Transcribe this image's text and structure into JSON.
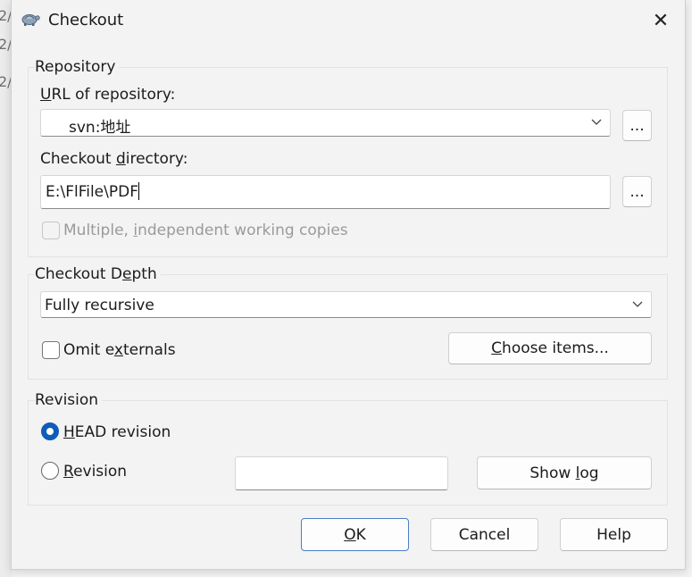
{
  "dialog": {
    "title": "Checkout",
    "close_symbol": "✕"
  },
  "repository": {
    "group_title": "Repository",
    "url_label_pre": "",
    "url_label_mnemonic": "U",
    "url_label_post": "RL of repository:",
    "url_value": "svn:地址",
    "browse_label": "...",
    "dir_label_pre": "Checkout ",
    "dir_label_mnemonic": "d",
    "dir_label_post": "irectory:",
    "dir_value": "E:\\FlFile\\PDF",
    "browse_dir_label": "...",
    "multiple_pre": "Multiple, ",
    "multiple_mnemonic": "i",
    "multiple_post": "ndependent working copies"
  },
  "depth": {
    "group_title_pre": "Checkout D",
    "group_title_mnemonic": "e",
    "group_title_post": "pth",
    "value": "Fully recursive",
    "omit_pre": "Omit e",
    "omit_mnemonic": "x",
    "omit_post": "ternals",
    "choose_pre": "",
    "choose_mnemonic": "C",
    "choose_post": "hoose items..."
  },
  "revision": {
    "group_title": "Revision",
    "head_pre": "",
    "head_mnemonic": "H",
    "head_post": "EAD revision",
    "rev_pre": "",
    "rev_mnemonic": "R",
    "rev_post": "evision",
    "rev_value": "",
    "showlog_pre": "Show ",
    "showlog_mnemonic": "l",
    "showlog_post": "og"
  },
  "buttons": {
    "ok_mnemonic": "O",
    "ok_post": "K",
    "cancel": "Cancel",
    "help": "Help"
  },
  "background": {
    "text_lines": [
      "2/",
      "2/",
      "2/"
    ]
  }
}
